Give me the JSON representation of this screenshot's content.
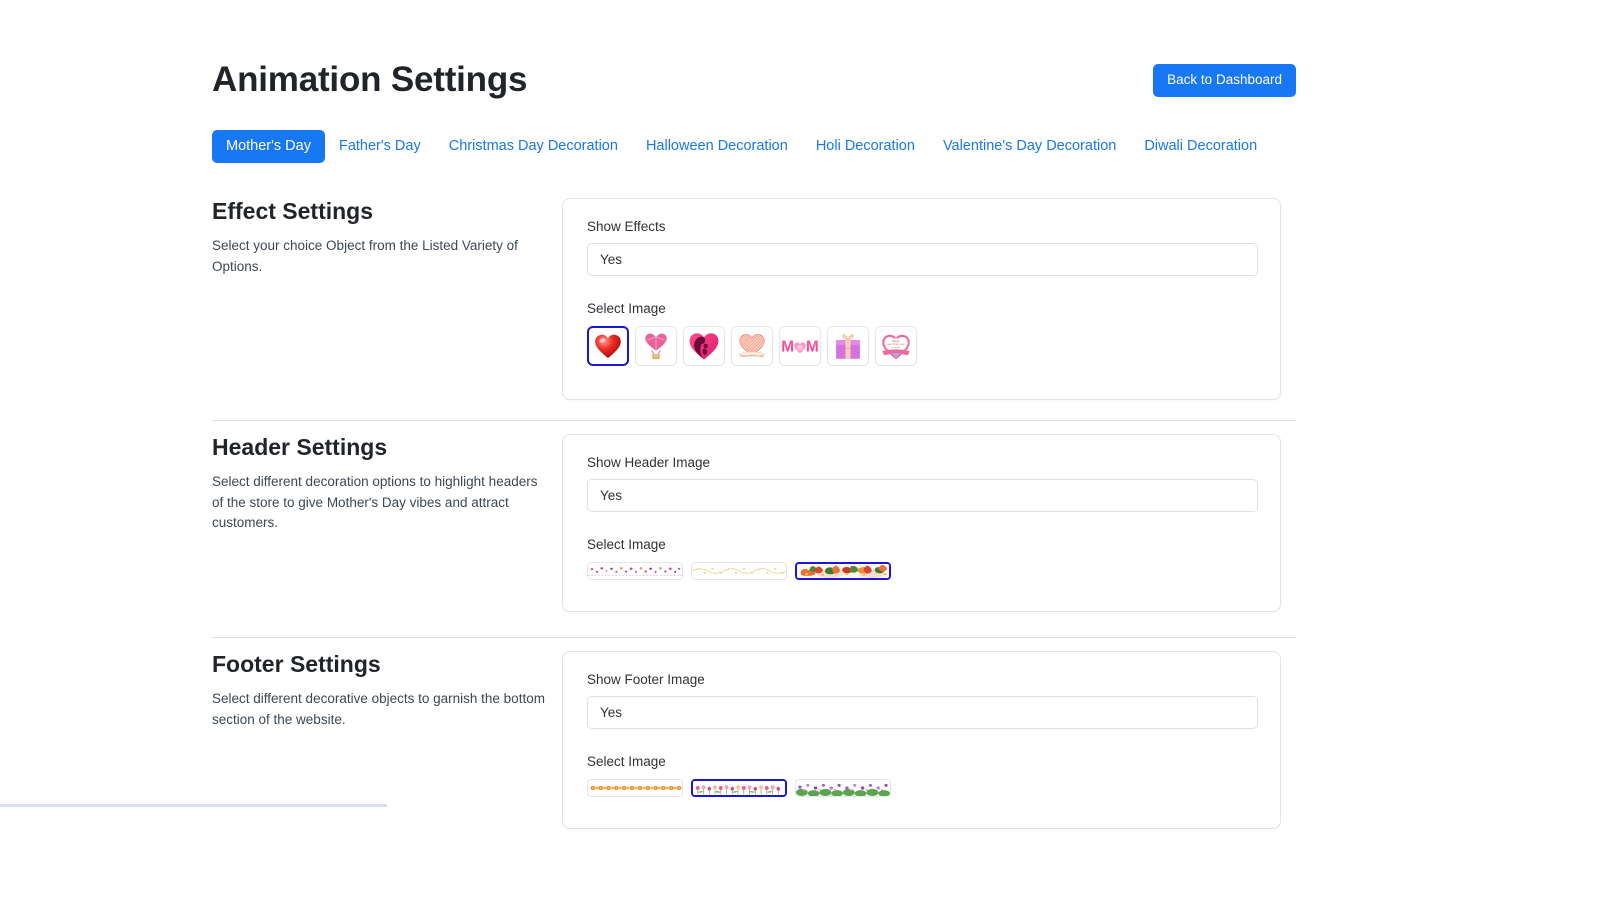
{
  "header": {
    "title": "Animation Settings",
    "dashboard_button": "Back to Dashboard"
  },
  "tabs": [
    {
      "label": "Mother's Day",
      "active": true
    },
    {
      "label": "Father's Day",
      "active": false
    },
    {
      "label": "Christmas Day Decoration",
      "active": false
    },
    {
      "label": "Halloween Decoration",
      "active": false
    },
    {
      "label": "Holi Decoration",
      "active": false
    },
    {
      "label": "Valentine's Day Decoration",
      "active": false
    },
    {
      "label": "Diwali Decoration",
      "active": false
    }
  ],
  "sections": {
    "effect": {
      "title": "Effect Settings",
      "description": "Select your choice Object from the Listed Variety of Options.",
      "toggle_label": "Show Effects",
      "toggle_value": "Yes",
      "select_image_label": "Select Image",
      "images": [
        {
          "name": "red-heart",
          "selected": true
        },
        {
          "name": "heart-balloon",
          "selected": false
        },
        {
          "name": "mother-child-heart",
          "selected": false
        },
        {
          "name": "striped-heart-banner",
          "selected": false
        },
        {
          "name": "mom-text-heart",
          "selected": false
        },
        {
          "name": "pink-gift-box",
          "selected": false
        },
        {
          "name": "happy-mothers-day-heart-card",
          "selected": false
        }
      ]
    },
    "headerSettings": {
      "title": "Header Settings",
      "description": "Select different decoration options to highlight headers of the store to give Mother's Day vibes and attract customers.",
      "toggle_label": "Show Header Image",
      "toggle_value": "Yes",
      "select_image_label": "Select Image",
      "images": [
        {
          "name": "dotted-hearts-banner",
          "selected": false
        },
        {
          "name": "yellow-vine-banner",
          "selected": false
        },
        {
          "name": "floral-autumn-banner",
          "selected": true
        }
      ]
    },
    "footerSettings": {
      "title": "Footer Settings",
      "description": "Select different decorative objects to garnish the bottom section of the website.",
      "toggle_label": "Show Footer Image",
      "toggle_value": "Yes",
      "select_image_label": "Select Image",
      "images": [
        {
          "name": "orange-pinwheel-flower-banner",
          "selected": false
        },
        {
          "name": "pink-tulip-field-banner",
          "selected": true
        },
        {
          "name": "purple-green-flower-banner",
          "selected": false
        }
      ]
    }
  },
  "colors": {
    "accent": "#1877f2",
    "selected_border": "#1a17d6",
    "text": "#212529",
    "border": "#e3e3e3"
  }
}
